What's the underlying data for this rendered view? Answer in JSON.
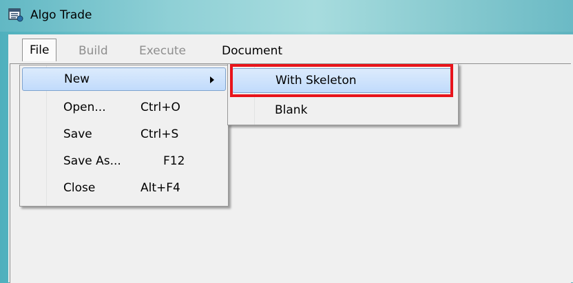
{
  "window": {
    "title": "Algo Trade"
  },
  "menubar": {
    "items": [
      {
        "label": "File",
        "enabled": true,
        "open": true
      },
      {
        "label": "Build",
        "enabled": false
      },
      {
        "label": "Execute",
        "enabled": false
      },
      {
        "label": "Document",
        "enabled": true
      }
    ]
  },
  "file_menu": {
    "items": [
      {
        "label": "New",
        "shortcut": "",
        "has_submenu": true,
        "highlighted": true
      },
      {
        "label": "Open...",
        "shortcut": "Ctrl+O"
      },
      {
        "label": "Save",
        "shortcut": "Ctrl+S"
      },
      {
        "label": "Save As...",
        "shortcut": "F12"
      },
      {
        "label": "Close",
        "shortcut": "Alt+F4"
      }
    ]
  },
  "new_submenu": {
    "items": [
      {
        "label": "With Skeleton",
        "highlighted": true
      },
      {
        "label": "Blank"
      }
    ]
  },
  "colors": {
    "highlight_border": "#7da2ce",
    "annotation_red": "#e8141b",
    "title_gradient_mid": "#a7dcde"
  },
  "icons": {
    "app": "app-window-icon",
    "submenu": "chevron-right-icon"
  }
}
